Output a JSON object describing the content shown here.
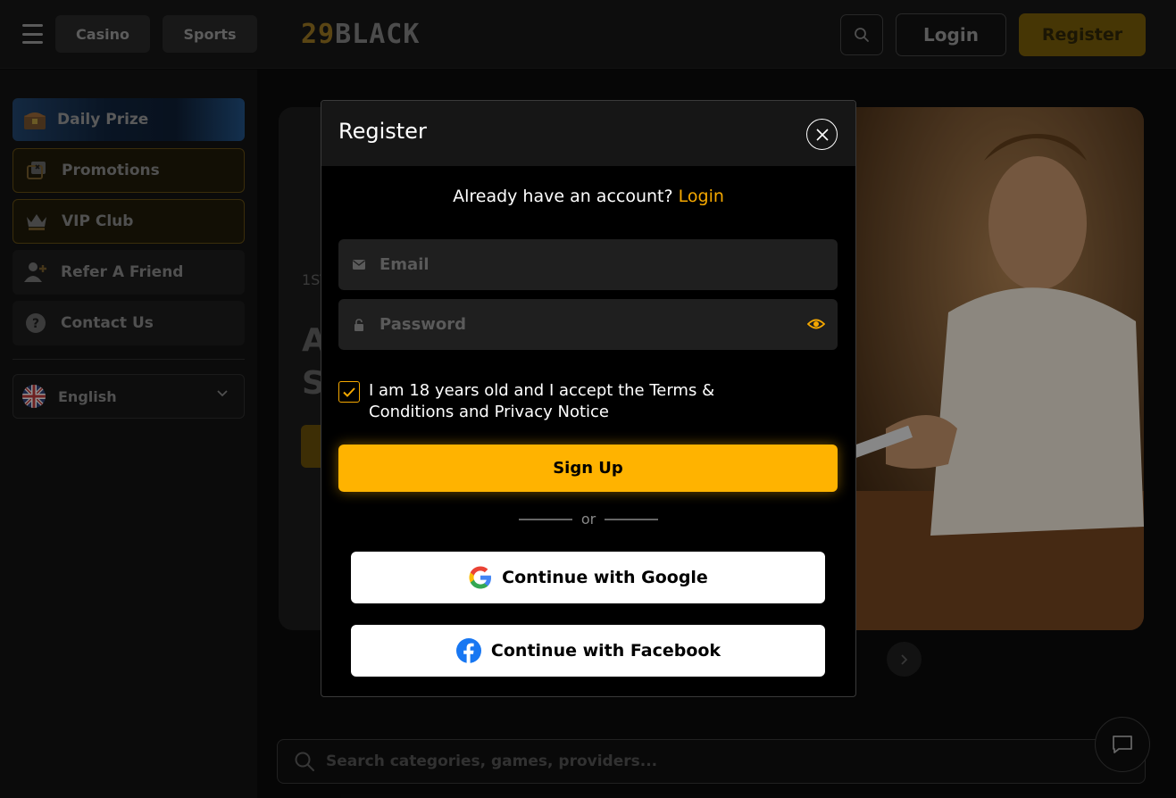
{
  "header": {
    "tabs": [
      "Casino",
      "Sports"
    ],
    "logo_number": "29",
    "logo_word": "BLACK",
    "login_label": "Login",
    "register_label": "Register"
  },
  "sidebar": {
    "items": [
      {
        "label": "Daily Prize",
        "icon": "treasure-chest-icon"
      },
      {
        "label": "Promotions",
        "icon": "promotions-icon"
      },
      {
        "label": "VIP Club",
        "icon": "crown-icon"
      },
      {
        "label": "Refer A Friend",
        "icon": "add-user-icon"
      },
      {
        "label": "Contact Us",
        "icon": "help-icon"
      }
    ],
    "language": "English"
  },
  "banner": {
    "subtitle": "1ST",
    "headline_line1": "A",
    "headline_line2": "S"
  },
  "main_search": {
    "placeholder": "Search categories, games, providers..."
  },
  "modal": {
    "title": "Register",
    "have_account_text": "Already have an account?",
    "login_link": "Login",
    "email_placeholder": "Email",
    "password_placeholder": "Password",
    "consent_text": "I am 18 years old and I accept the Terms & Conditions and  Privacy Notice",
    "consent_checked": true,
    "signup_label": "Sign Up",
    "or_label": "or",
    "google_label": "Continue with Google",
    "facebook_label": "Continue with Facebook"
  },
  "colors": {
    "accent": "#ffb300",
    "link": "#f5a800",
    "background": "#0a0a0a",
    "modal_bg": "#000000"
  }
}
